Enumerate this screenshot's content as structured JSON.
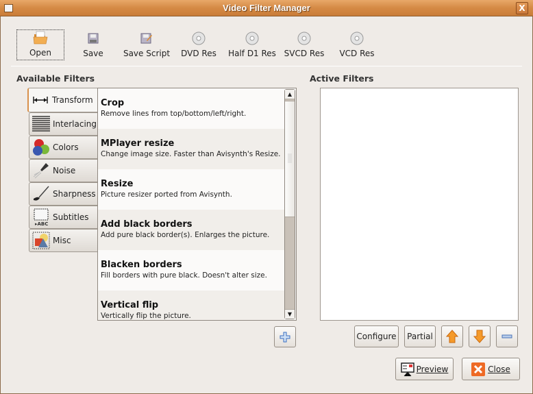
{
  "window": {
    "title": "Video Filter Manager"
  },
  "toolbar": [
    {
      "label": "Open",
      "icon": "folder-open-icon"
    },
    {
      "label": "Save",
      "icon": "floppy-save-icon"
    },
    {
      "label": "Save Script",
      "icon": "floppy-edit-icon"
    },
    {
      "label": "DVD Res",
      "icon": "disc-icon"
    },
    {
      "label": "Half D1 Res",
      "icon": "disc-icon"
    },
    {
      "label": "SVCD Res",
      "icon": "disc-icon"
    },
    {
      "label": "VCD Res",
      "icon": "disc-icon"
    }
  ],
  "available": {
    "label": "Available Filters",
    "tabs": [
      {
        "label": "Transform",
        "icon": "transform-arrow-icon",
        "active": true
      },
      {
        "label": "Interlacing",
        "icon": "interlace-lines-icon"
      },
      {
        "label": "Colors",
        "icon": "color-balls-icon"
      },
      {
        "label": "Noise",
        "icon": "noise-spray-icon"
      },
      {
        "label": "Sharpness",
        "icon": "brush-icon"
      },
      {
        "label": "Subtitles",
        "icon": "subtitle-abc-icon"
      },
      {
        "label": "Misc",
        "icon": "shapes-icon"
      }
    ],
    "filters": [
      {
        "title": "Crop",
        "desc": "Remove lines from top/bottom/left/right."
      },
      {
        "title": "MPlayer resize",
        "desc": "Change image size. Faster than Avisynth's Resize."
      },
      {
        "title": "Resize",
        "desc": "Picture resizer ported from Avisynth."
      },
      {
        "title": "Add black borders",
        "desc": "Add pure black border(s). Enlarges the picture."
      },
      {
        "title": "Blacken borders",
        "desc": "Fill borders with pure black. Doesn't alter size."
      },
      {
        "title": "Vertical flip",
        "desc": "Vertically flip the picture."
      }
    ]
  },
  "active": {
    "label": "Active Filters"
  },
  "buttons": {
    "configure": "Configure",
    "partial": "Partial",
    "preview": "Preview",
    "close": "Close"
  },
  "colors": {
    "titlebar": "#d58a45",
    "accent_orange": "#f08a1c",
    "close_red": "#e8581f"
  }
}
